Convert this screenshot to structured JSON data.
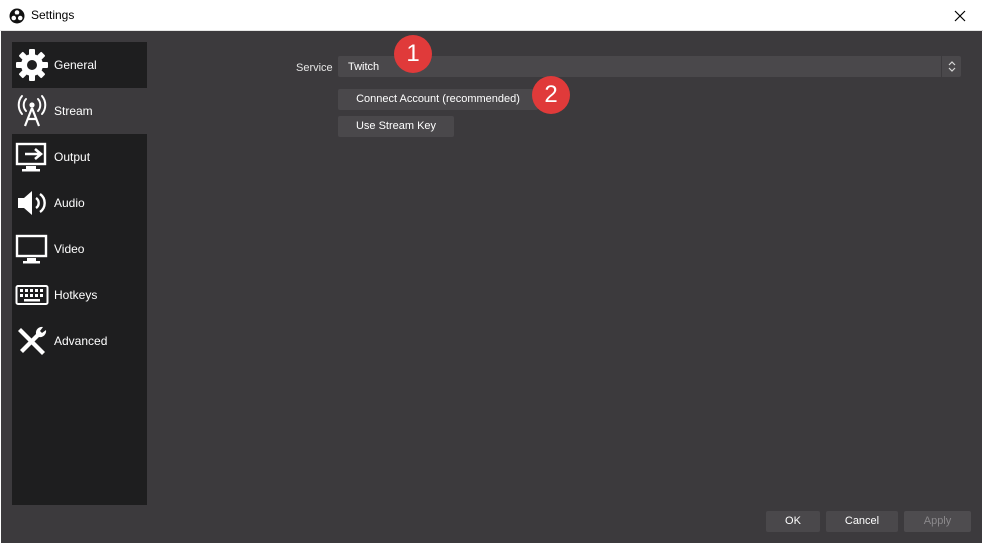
{
  "window": {
    "title": "Settings",
    "app_icon": "obs-logo-icon",
    "close_icon": "close-icon"
  },
  "sidebar": {
    "items": [
      {
        "label": "General",
        "icon": "gear-icon",
        "selected": false
      },
      {
        "label": "Stream",
        "icon": "broadcast-antenna-icon",
        "selected": true
      },
      {
        "label": "Output",
        "icon": "monitor-output-icon",
        "selected": false
      },
      {
        "label": "Audio",
        "icon": "speaker-icon",
        "selected": false
      },
      {
        "label": "Video",
        "icon": "monitor-icon",
        "selected": false
      },
      {
        "label": "Hotkeys",
        "icon": "keyboard-icon",
        "selected": false
      },
      {
        "label": "Advanced",
        "icon": "tools-icon",
        "selected": false
      }
    ]
  },
  "stream": {
    "service_label": "Service",
    "service_value": "Twitch",
    "connect_account_label": "Connect Account (recommended)",
    "use_stream_key_label": "Use Stream Key"
  },
  "annotations": {
    "badge_1": "1",
    "badge_2": "2",
    "badge_color": "#e03a3a"
  },
  "footer": {
    "ok_label": "OK",
    "cancel_label": "Cancel",
    "apply_label": "Apply"
  },
  "colors": {
    "background": "#3c3a3d",
    "sidebar": "#1e1e1f",
    "control": "#4a484b"
  }
}
